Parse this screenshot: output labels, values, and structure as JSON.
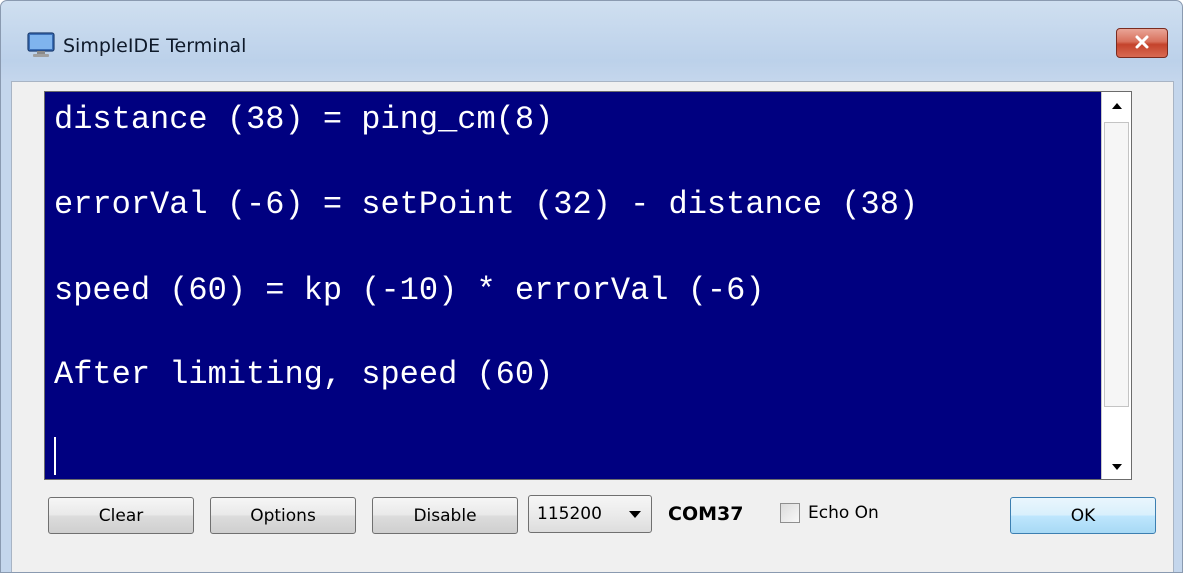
{
  "window": {
    "title": "SimpleIDE Terminal",
    "icon": "monitor-icon",
    "close_icon": "close-icon"
  },
  "terminal": {
    "background_color": "#000080",
    "text_color": "#ffffff",
    "lines": [
      "distance (38) = ping_cm(8)",
      "errorVal (-6) = setPoint (32) - distance (38)",
      "speed (60) = kp (-10) * errorVal (-6)",
      "After limiting, speed (60)"
    ]
  },
  "toolbar": {
    "clear_label": "Clear",
    "options_label": "Options",
    "disable_label": "Disable",
    "baud_selected": "115200",
    "port_label": "COM37",
    "echo_label": "Echo On",
    "echo_checked": false,
    "ok_label": "OK"
  }
}
